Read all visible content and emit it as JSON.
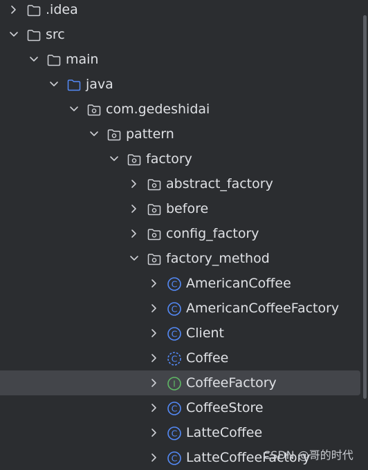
{
  "tree": [
    {
      "name": ".idea",
      "type": "folder",
      "expanded": false
    },
    {
      "name": "src",
      "type": "folder",
      "expanded": true
    },
    {
      "name": "main",
      "type": "folder",
      "expanded": true
    },
    {
      "name": "java",
      "type": "source-root",
      "expanded": true
    },
    {
      "name": "com.gedeshidai",
      "type": "package",
      "expanded": true
    },
    {
      "name": "pattern",
      "type": "package",
      "expanded": true
    },
    {
      "name": "factory",
      "type": "package",
      "expanded": true
    },
    {
      "name": "abstract_factory",
      "type": "package",
      "expanded": false
    },
    {
      "name": "before",
      "type": "package",
      "expanded": false
    },
    {
      "name": "config_factory",
      "type": "package",
      "expanded": false
    },
    {
      "name": "factory_method",
      "type": "package",
      "expanded": true
    },
    {
      "name": "AmericanCoffee",
      "type": "class",
      "expanded": false
    },
    {
      "name": "AmericanCoffeeFactory",
      "type": "class",
      "expanded": false
    },
    {
      "name": "Client",
      "type": "class",
      "expanded": false
    },
    {
      "name": "Coffee",
      "type": "abstract-class",
      "expanded": false
    },
    {
      "name": "CoffeeFactory",
      "type": "interface",
      "expanded": false,
      "selected": true
    },
    {
      "name": "CoffeeStore",
      "type": "class",
      "expanded": false
    },
    {
      "name": "LatteCoffee",
      "type": "class",
      "expanded": false
    },
    {
      "name": "LatteCoffeeFactory",
      "type": "class",
      "expanded": false
    }
  ],
  "watermark": "CSDN @哥的时代",
  "colors": {
    "background": "#2b2d30",
    "text": "#dfe1e5",
    "selection": "#43454a",
    "class_icon": "#548af7",
    "interface_icon": "#5fb865",
    "source_root": "#548af7"
  }
}
